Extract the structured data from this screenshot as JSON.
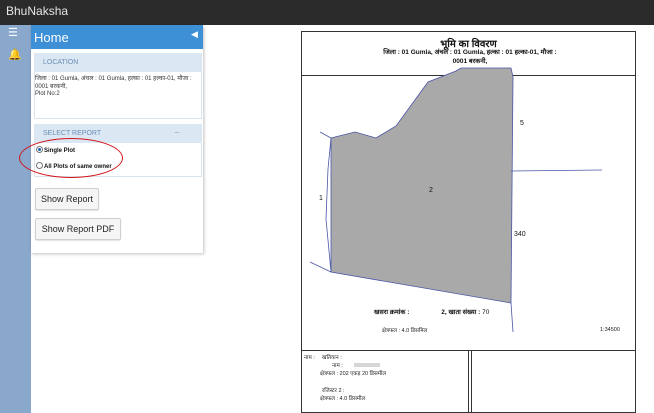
{
  "app": {
    "brand": "BhuNaksha"
  },
  "rail": {
    "menu_icon": "hamburger-icon",
    "bell_icon": "bell-icon"
  },
  "panel": {
    "title": "Home",
    "location_header": "LOCATION",
    "location_text": "जिला : 01 Gumla, अंचल : 01 Gumla, हल्का : 01 हल्का-01, मौजा : 0001 बरकनी,",
    "plot_text": "Plot No:2",
    "report_header": "SELECT REPORT",
    "dots": "..",
    "options": [
      {
        "label": "Single Plot",
        "selected": true
      },
      {
        "label": "All Plots of same owner",
        "selected": false
      }
    ],
    "show_report_label": "Show Report",
    "show_report_pdf_label": "Show Report PDF",
    "highlight_color": "#d4161b"
  },
  "report": {
    "title": "भूमि का विवरण",
    "subtitle_line1": "जिला : 01 Gumla, अंचल : 01 Gumla, हल्का : 01 हल्का-01, मौजा :",
    "subtitle_line2": "0001 बरकनी,",
    "plot_label": "2",
    "neighbors": {
      "left": "1",
      "top_right": "5",
      "right": "340"
    },
    "khasra_label": "खसरा क्रमांक :",
    "khasra_value": "2",
    "khata_label": ", खाता संख्या :",
    "khata_value": "70",
    "area_text": "क्षेत्रफल : 4.0 डिसमिल",
    "scale": "1:34500",
    "owner": {
      "name_label": "नाम :",
      "khatian_label": "खतियान :",
      "name_field": "नाम :",
      "total_area": "क्षेत्रफल : 202 एकड़ 20 डिसमील",
      "register": "रजिस्टर 2 :",
      "area": "क्षेत्रफल : 4.0 डिसमील"
    }
  }
}
